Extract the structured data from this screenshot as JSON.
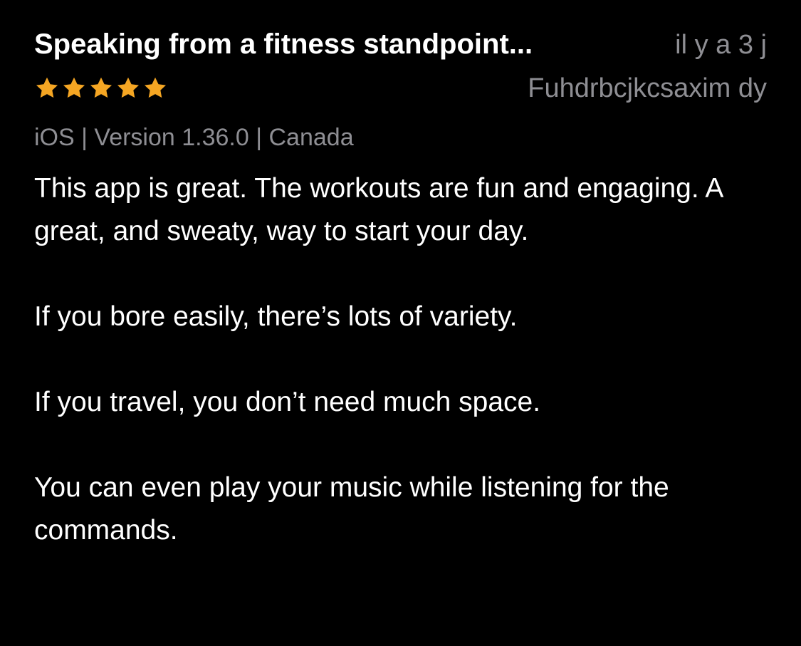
{
  "review": {
    "title": "Speaking from a fitness standpoint...",
    "date": "il y a 3 j",
    "rating": 5,
    "rating_max": 5,
    "star_color": "#f5a623",
    "author": "Fuhdrbcjkcsaxim dy",
    "meta": "iOS | Version 1.36.0 | Canada",
    "paragraphs": [
      "This app is great. The workouts are fun and engaging. A great, and sweaty, way to start your day.",
      "If you bore easily, there’s lots of variety.",
      "If you travel, you don’t need much space.",
      "You can even play your music while listening for the commands."
    ]
  },
  "colors": {
    "background": "#000000",
    "primary_text": "#ffffff",
    "secondary_text": "#8e8e93"
  }
}
